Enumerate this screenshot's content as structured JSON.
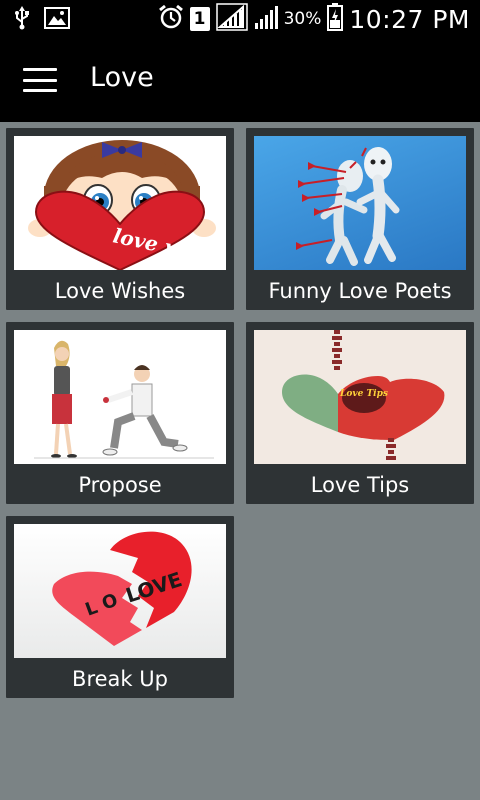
{
  "status_bar": {
    "sim_slot": "1",
    "battery_percent": "30%",
    "time": "10:27 PM"
  },
  "app_bar": {
    "title": "Love"
  },
  "tiles": [
    {
      "label": "Love Wishes",
      "image_text": "love you"
    },
    {
      "label": "Funny Love Poets"
    },
    {
      "label": "Propose"
    },
    {
      "label": "Love Tips",
      "image_text": "Love Tips"
    },
    {
      "label": "Break Up",
      "image_text": "LOVE"
    }
  ],
  "colors": {
    "background": "#7b8385",
    "tile": "#2e3335",
    "app_bar": "#000000",
    "heart_red": "#d7202b"
  }
}
